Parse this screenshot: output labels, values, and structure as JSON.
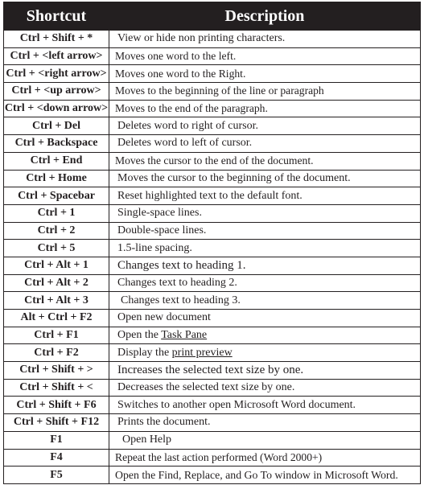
{
  "header": {
    "shortcut": "Shortcut",
    "description": "Description"
  },
  "rows": [
    {
      "key": "Ctrl + Shift + *",
      "desc": "View or hide non printing characters."
    },
    {
      "key": "Ctrl + <left arrow>",
      "desc": "Moves one word to the left."
    },
    {
      "key": "Ctrl + <right arrow>",
      "desc": "Moves one word to the Right."
    },
    {
      "key": "Ctrl + <up arrow>",
      "desc": "Moves to the beginning of the line or paragraph"
    },
    {
      "key": "Ctrl + <down arrow>",
      "desc": "Moves to the end of the paragraph."
    },
    {
      "key": "Ctrl + Del",
      "desc": "Deletes word to right of cursor."
    },
    {
      "key": "Ctrl + Backspace",
      "desc": "Deletes word to left of cursor."
    },
    {
      "key": "Ctrl + End",
      "desc": "Moves the cursor to the end of the document."
    },
    {
      "key": "Ctrl + Home",
      "desc": "Moves the cursor to the beginning of the document."
    },
    {
      "key": "Ctrl + Spacebar",
      "desc": "Reset highlighted text to the default font."
    },
    {
      "key": "Ctrl + 1",
      "desc": "Single-space lines."
    },
    {
      "key": "Ctrl + 2",
      "desc": "Double-space lines."
    },
    {
      "key": "Ctrl + 5",
      "desc": "1.5-line spacing."
    },
    {
      "key": "Ctrl + Alt + 1",
      "desc": "Changes text to heading 1."
    },
    {
      "key": "Ctrl + Alt + 2",
      "desc": "Changes text to heading 2."
    },
    {
      "key": "Ctrl + Alt + 3",
      "desc": "Changes text to heading 3."
    },
    {
      "key": "Alt + Ctrl + F2",
      "desc": "Open new document"
    },
    {
      "key": "Ctrl + F1",
      "desc_prefix": "Open the ",
      "desc_link": "Task Pane"
    },
    {
      "key": "Ctrl + F2",
      "desc_prefix": "Display the ",
      "desc_link": "print preview"
    },
    {
      "key": "Ctrl + Shift + >",
      "desc": "Increases the selected text size by one."
    },
    {
      "key": "Ctrl + Shift + <",
      "desc": "Decreases the selected text size by one."
    },
    {
      "key": "Ctrl + Shift + F6",
      "desc": "Switches to another open Microsoft Word document."
    },
    {
      "key": "Ctrl + Shift + F12",
      "desc": "Prints the document."
    },
    {
      "key": "F1",
      "desc": "Open Help"
    },
    {
      "key": "F4",
      "desc": "Repeat the last action performed (Word 2000+)"
    },
    {
      "key": "F5",
      "desc": "Open the Find, Replace, and Go To window in Microsoft Word."
    }
  ]
}
